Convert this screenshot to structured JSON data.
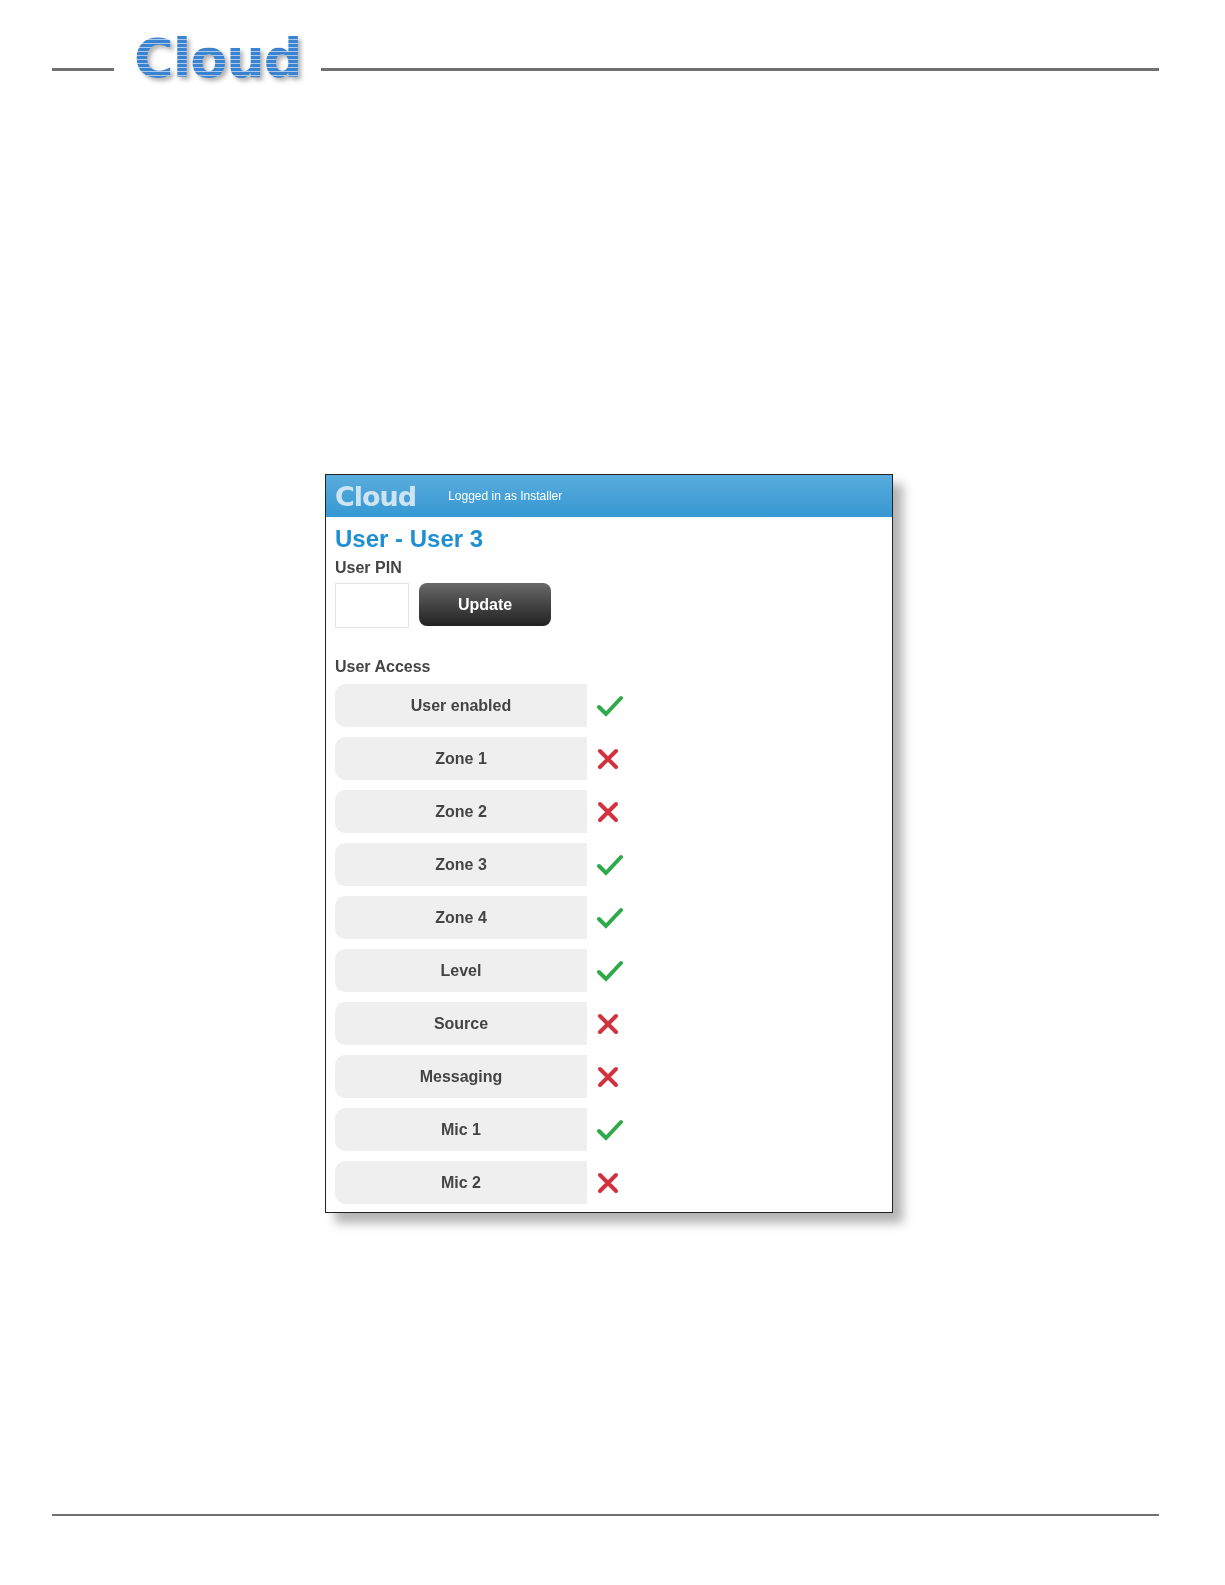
{
  "page_header": {
    "logo": "Cloud"
  },
  "app": {
    "logo": "Cloud",
    "login_status": "Logged in as Installer",
    "title": "User - User 3",
    "pin_label": "User PIN",
    "update_button": "Update",
    "access_label": "User Access",
    "access": [
      {
        "label": "User enabled",
        "on": true
      },
      {
        "label": "Zone 1",
        "on": false
      },
      {
        "label": "Zone 2",
        "on": false
      },
      {
        "label": "Zone 3",
        "on": true
      },
      {
        "label": "Zone 4",
        "on": true
      },
      {
        "label": "Level",
        "on": true
      },
      {
        "label": "Source",
        "on": false
      },
      {
        "label": "Messaging",
        "on": false
      },
      {
        "label": "Mic 1",
        "on": true
      },
      {
        "label": "Mic 2",
        "on": false
      }
    ]
  }
}
